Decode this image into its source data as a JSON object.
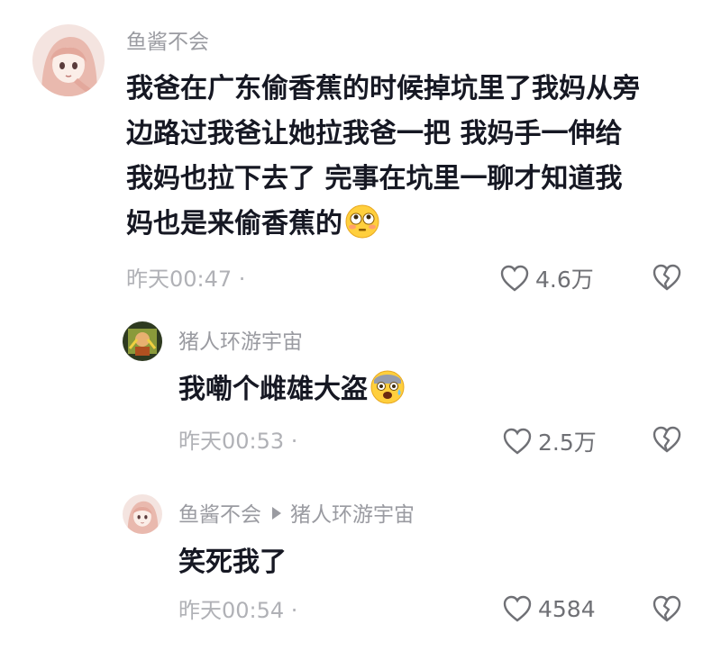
{
  "comments": [
    {
      "username": "鱼酱不会",
      "text": "我爸在广东偷香蕉的时候掉坑里了我妈从旁边路过我爸让她拉我爸一把 我妈手一伸给我妈也拉下去了 完事在坑里一聊才知道我妈也是来偷香蕉的",
      "text_lines": [
        "我爸在广东偷香蕉的时候掉坑里了我妈从旁",
        "边路过我爸让她拉我爸一把 我妈手一伸给",
        "我妈也拉下去了 完事在坑里一聊才知道我",
        "妈也是来偷香蕉的"
      ],
      "emoji": "flushed-face-emoji",
      "time": "昨天00:47 ·",
      "likes": "4.6万"
    },
    {
      "username": "猪人环游宇宙",
      "text": "我嘞个雌雄大盗",
      "emoji": "fearful-face-emoji",
      "time": "昨天00:53 ·",
      "likes": "2.5万"
    },
    {
      "username": "鱼酱不会",
      "reply_to": "猪人环游宇宙",
      "text": "笑死我了",
      "time": "昨天00:54 ·",
      "likes": "4584"
    }
  ],
  "colors": {
    "text": "#161823",
    "username": "#9a9ba1",
    "meta": "#b0b1b6",
    "icon": "#6f7075"
  }
}
